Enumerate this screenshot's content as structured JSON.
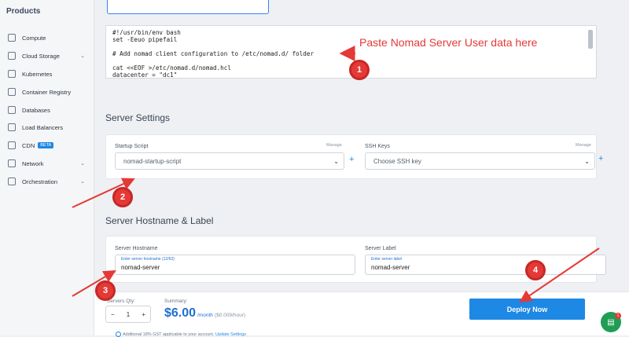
{
  "sidebar": {
    "title": "Products",
    "items": [
      {
        "label": "Compute",
        "icon": "server-icon",
        "chevron": false,
        "beta": ""
      },
      {
        "label": "Cloud Storage",
        "icon": "storage-icon",
        "chevron": true,
        "beta": ""
      },
      {
        "label": "Kubernetes",
        "icon": "kubernetes-icon",
        "chevron": false,
        "beta": ""
      },
      {
        "label": "Container Registry",
        "icon": "registry-icon",
        "chevron": false,
        "beta": ""
      },
      {
        "label": "Databases",
        "icon": "database-icon",
        "chevron": false,
        "beta": ""
      },
      {
        "label": "Load Balancers",
        "icon": "load-balancer-icon",
        "chevron": false,
        "beta": ""
      },
      {
        "label": "CDN",
        "icon": "cdn-icon",
        "chevron": false,
        "beta": "BETA"
      },
      {
        "label": "Network",
        "icon": "network-icon",
        "chevron": true,
        "beta": ""
      },
      {
        "label": "Orchestration",
        "icon": "orchestration-icon",
        "chevron": true,
        "beta": ""
      }
    ]
  },
  "user_data": {
    "lines": "#!/usr/bin/env bash\nset -Eeuo pipefail\n\n# Add nomad client configuration to /etc/nomad.d/ folder\n\ncat <<EOF >/etc/nomad.d/nomad.hcl\ndatacenter = \"dc1\""
  },
  "server_settings": {
    "title": "Server Settings",
    "startup_label": "Startup Script",
    "startup_manage": "Manage",
    "startup_value": "nomad-startup-script",
    "ssh_label": "SSH Keys",
    "ssh_manage": "Manage",
    "ssh_value": "Choose SSH key",
    "plus": "+"
  },
  "hostname": {
    "title": "Server Hostname & Label",
    "hostname_label": "Server Hostname",
    "hostname_placeholder": "Enter server hostname (12/63)",
    "hostname_value": "nomad-server",
    "server_label_label": "Server Label",
    "server_label_placeholder": "Enter server label",
    "server_label_value": "nomad-server"
  },
  "footer": {
    "qty_label": "Servers Qty:",
    "qty_minus": "−",
    "qty_value": "1",
    "qty_plus": "+",
    "summary_label": "Summary:",
    "price": "$6.00",
    "per": "/month",
    "hourly": "($0.009/hour)",
    "deploy": "Deploy Now",
    "note": "Additional 18% GST applicable to your account.",
    "note_link": "Update Settings"
  },
  "annotations": {
    "text": "Paste Nomad Server User data here",
    "badges": [
      "1",
      "2",
      "3",
      "4"
    ],
    "color": "#e53935"
  },
  "chat": {
    "badge": "1"
  }
}
